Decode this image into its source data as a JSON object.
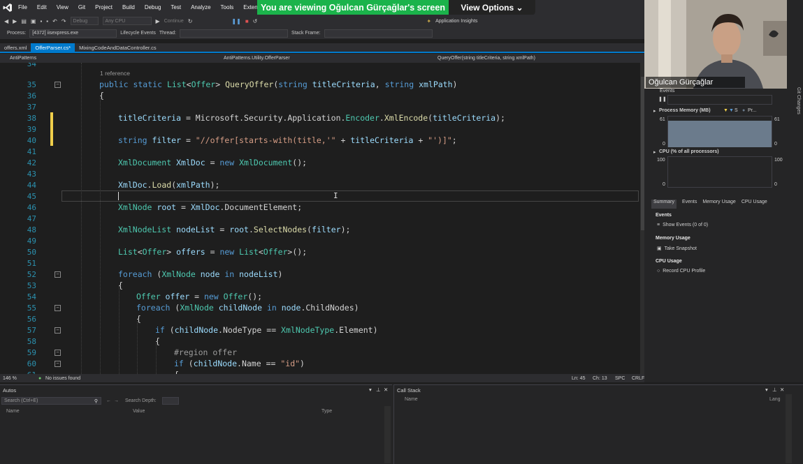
{
  "menubar": {
    "logo": "VS",
    "items": [
      "File",
      "Edit",
      "View",
      "Git",
      "Project",
      "Build",
      "Debug",
      "Test",
      "Analyze",
      "Tools",
      "Extensions"
    ]
  },
  "share_banner": {
    "text": "You are viewing Oğulcan Gürçağlar's screen",
    "view_options": "View Options",
    "color": "#1bb34b"
  },
  "toolbar": {
    "config": "Debug",
    "platform": "Any CPU",
    "continue": "Continue",
    "app_insights": "Application Insights",
    "process_label": "Process:",
    "process_value": "[4372] iisexpress.exe",
    "lifecycle": "Lifecycle Events",
    "thread": "Thread:",
    "stack_frame": "Stack Frame:"
  },
  "tabs": [
    {
      "label": "offers.xml",
      "active": false
    },
    {
      "label": "OfferParser.cs*",
      "active": true
    },
    {
      "label": "MixingCodeAndDataController.cs",
      "active": false
    }
  ],
  "navbar": {
    "project": "AntiPatterns",
    "class": "AntiPatterns.Utility.OfferParser",
    "member": "QueryOffer(string titleCriteria, string xmlPath)"
  },
  "editor": {
    "reference_hint": "1 reference",
    "lines": [
      {
        "n": "34",
        "code": ""
      },
      {
        "n": "35",
        "code": "public static List<Offer> QueryOffer(string titleCriteria, string xmlPath)"
      },
      {
        "n": "36",
        "code": "{"
      },
      {
        "n": "37",
        "code": ""
      },
      {
        "n": "38",
        "code": "titleCriteria = Microsoft.Security.Application.Encoder.XmlEncode(titleCriteria);"
      },
      {
        "n": "39",
        "code": ""
      },
      {
        "n": "40",
        "code": "string filter = \"//offer[starts-with(title,'\" + titleCriteria + \"')]\";"
      },
      {
        "n": "41",
        "code": ""
      },
      {
        "n": "42",
        "code": "XmlDocument XmlDoc = new XmlDocument();"
      },
      {
        "n": "43",
        "code": ""
      },
      {
        "n": "44",
        "code": "XmlDoc.Load(xmlPath);"
      },
      {
        "n": "45",
        "code": ""
      },
      {
        "n": "46",
        "code": "XmlNode root = XmlDoc.DocumentElement;"
      },
      {
        "n": "47",
        "code": ""
      },
      {
        "n": "48",
        "code": "XmlNodeList nodeList = root.SelectNodes(filter);"
      },
      {
        "n": "49",
        "code": ""
      },
      {
        "n": "50",
        "code": "List<Offer> offers = new List<Offer>();"
      },
      {
        "n": "51",
        "code": ""
      },
      {
        "n": "52",
        "code": "foreach (XmlNode node in nodeList)"
      },
      {
        "n": "53",
        "code": "{"
      },
      {
        "n": "54",
        "code": "Offer offer = new Offer();"
      },
      {
        "n": "55",
        "code": "foreach (XmlNode childNode in node.ChildNodes)"
      },
      {
        "n": "56",
        "code": "{"
      },
      {
        "n": "57",
        "code": "if (childNode.NodeType == XmlNodeType.Element)"
      },
      {
        "n": "58",
        "code": "{"
      },
      {
        "n": "59",
        "code": "#region offer"
      },
      {
        "n": "60",
        "code": "if (childNode.Name == \"id\")"
      },
      {
        "n": "61",
        "code": "{"
      }
    ]
  },
  "status": {
    "zoom": "146 %",
    "issues": "No issues found",
    "line": "Ln: 45",
    "col": "Ch: 13",
    "spc": "SPC",
    "crlf": "CRLF"
  },
  "webcam": {
    "name": "Oğulcan Gürçağlar"
  },
  "diagnostics": {
    "events_label": "Events",
    "memory_label": "Process Memory (MB)",
    "memory_legend_s": "S",
    "memory_legend_pr": "Pr...",
    "memory_max": "61",
    "memory_min": "0",
    "memory_fill_fraction": 0.85,
    "cpu_label": "CPU (% of all processors)",
    "cpu_max": "100",
    "cpu_min": "0",
    "tabs": [
      "Summary",
      "Events",
      "Memory Usage",
      "CPU Usage"
    ],
    "active_tab": "Summary",
    "section_events": "Events",
    "show_events": "Show Events (0 of 0)",
    "section_memory": "Memory Usage",
    "take_snapshot": "Take Snapshot",
    "section_cpu": "CPU Usage",
    "record_cpu": "Record CPU Profile",
    "git_changes": "Git Changes"
  },
  "autos": {
    "title": "Autos",
    "search_placeholder": "Search (Ctrl+E)",
    "search_depth": "Search Depth:",
    "columns": [
      "Name",
      "Value",
      "Type"
    ]
  },
  "callstack": {
    "title": "Call Stack",
    "columns": [
      "Name",
      "Lang"
    ]
  }
}
